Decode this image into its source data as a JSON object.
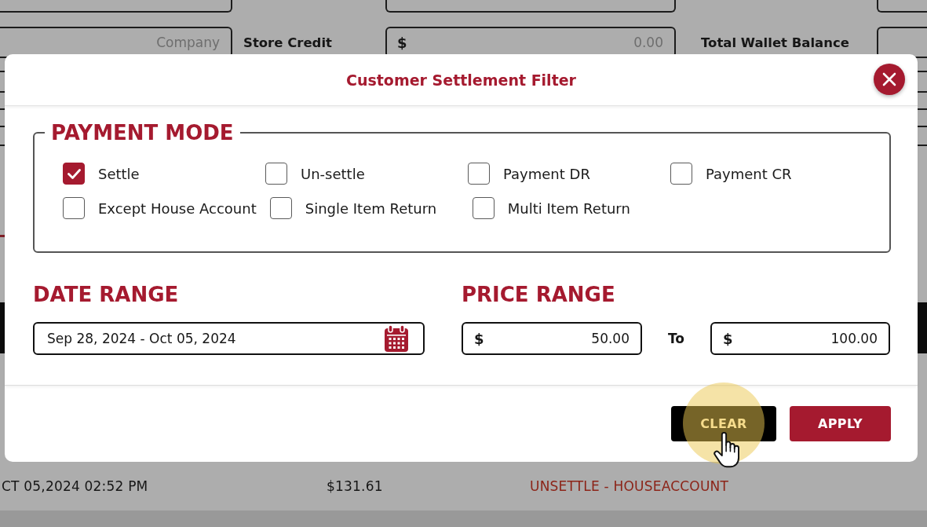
{
  "background": {
    "store_info": {
      "company": {
        "placeholder": "Company"
      },
      "store_credit": {
        "label": "Store Credit",
        "prefix": "$",
        "placeholder": "0.00"
      },
      "total_wallet_balance": {
        "label": "Total Wallet Balance"
      }
    },
    "transaction_row": {
      "date": "CT 05,2024 02:52 PM",
      "amount": "$131.61",
      "status": "UNSETTLE - HOUSEACCOUNT"
    }
  },
  "modal": {
    "title": "Customer Settlement Filter",
    "payment_mode": {
      "title": "PAYMENT MODE",
      "options": [
        {
          "label": "Settle",
          "checked": true
        },
        {
          "label": "Un-settle",
          "checked": false
        },
        {
          "label": "Payment DR",
          "checked": false
        },
        {
          "label": "Payment CR",
          "checked": false
        },
        {
          "label": "Except House Account",
          "checked": false
        },
        {
          "label": "Single Item Return",
          "checked": false
        },
        {
          "label": "Multi Item Return",
          "checked": false
        }
      ]
    },
    "date_range": {
      "title": "DATE RANGE",
      "value": "Sep 28, 2024 - Oct 05, 2024"
    },
    "price_range": {
      "title": "PRICE RANGE",
      "from": {
        "prefix": "$",
        "value": "50.00"
      },
      "separator": "To",
      "to": {
        "prefix": "$",
        "value": "100.00"
      }
    },
    "buttons": [
      {
        "label": "CLEAR",
        "kind": "secondary",
        "hovered": true
      },
      {
        "label": "APPLY",
        "kind": "primary",
        "hovered": false
      }
    ]
  }
}
